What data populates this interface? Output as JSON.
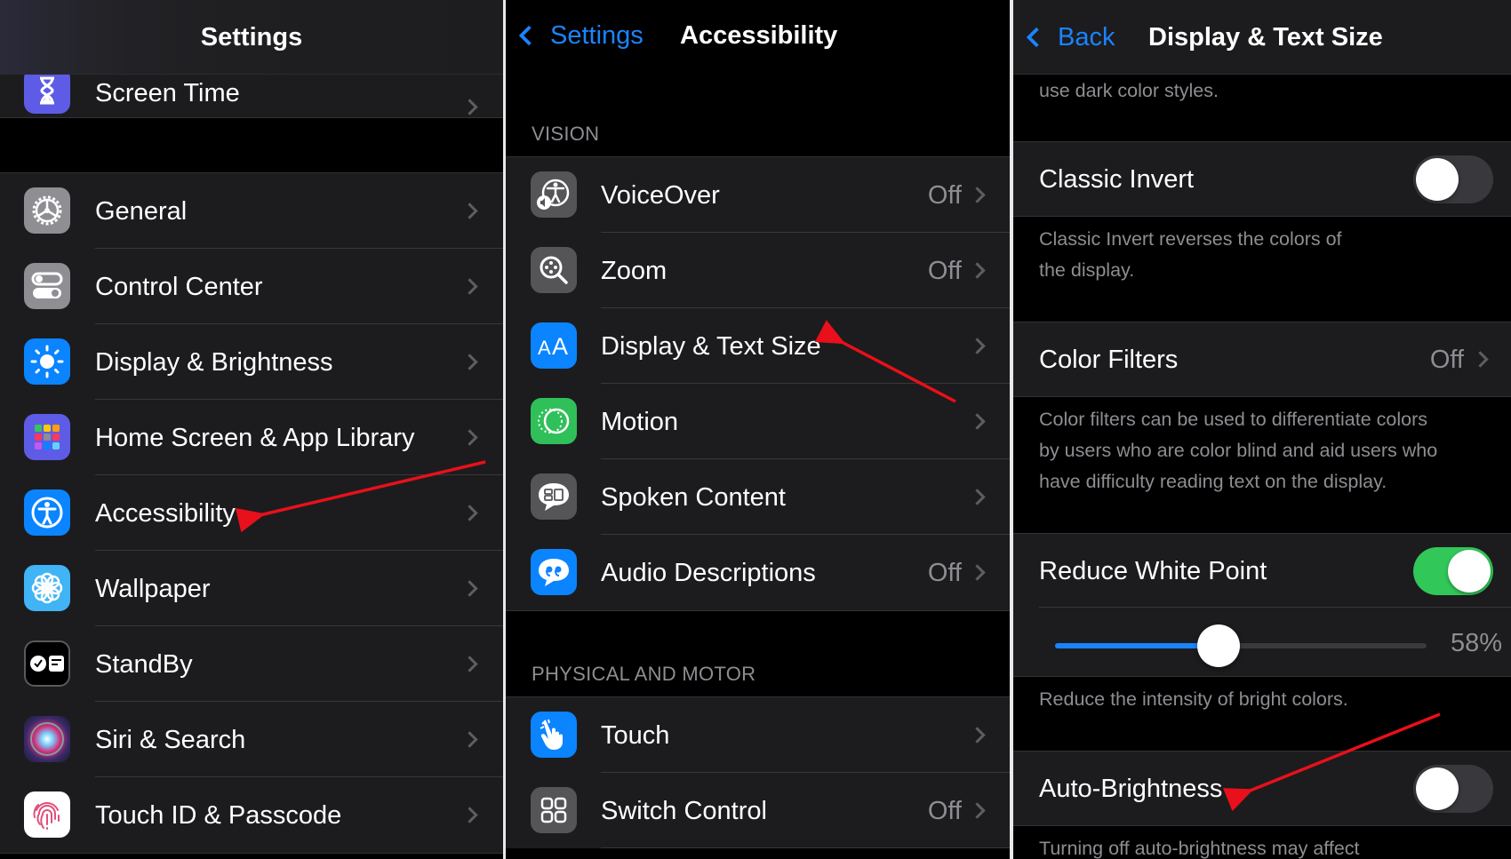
{
  "panels": {
    "settings": {
      "title": "Settings",
      "partial_row": {
        "label": "Screen Time",
        "icon": "hourglass-icon",
        "color": "#5e5ce6"
      },
      "rows": [
        {
          "label": "General",
          "icon": "gear-icon",
          "color": "#8e8e93"
        },
        {
          "label": "Control Center",
          "icon": "switches-icon",
          "color": "#8e8e93"
        },
        {
          "label": "Display & Brightness",
          "icon": "sun-icon",
          "color": "#0a84ff"
        },
        {
          "label": "Home Screen & App Library",
          "icon": "app-grid-icon",
          "color": "#5e5ce6"
        },
        {
          "label": "Accessibility",
          "icon": "accessibility-icon",
          "color": "#0a84ff"
        },
        {
          "label": "Wallpaper",
          "icon": "flower-icon",
          "color": "#40b4f5"
        },
        {
          "label": "StandBy",
          "icon": "standby-icon",
          "color": "#000000"
        },
        {
          "label": "Siri & Search",
          "icon": "siri-icon",
          "color": "#1a1a2e"
        },
        {
          "label": "Touch ID & Passcode",
          "icon": "fingerprint-icon",
          "color": "#ffffff"
        }
      ]
    },
    "accessibility": {
      "back_label": "Settings",
      "title": "Accessibility",
      "sections": [
        {
          "header": "VISION",
          "rows": [
            {
              "label": "VoiceOver",
              "value": "Off",
              "icon": "voiceover-icon",
              "color": "#555558"
            },
            {
              "label": "Zoom",
              "value": "Off",
              "icon": "zoom-icon",
              "color": "#555558"
            },
            {
              "label": "Display & Text Size",
              "value": "",
              "icon": "text-size-icon",
              "color": "#0a84ff"
            },
            {
              "label": "Motion",
              "value": "",
              "icon": "motion-icon",
              "color": "#30c05a"
            },
            {
              "label": "Spoken Content",
              "value": "",
              "icon": "speech-bubble-icon",
              "color": "#555558"
            },
            {
              "label": "Audio Descriptions",
              "value": "Off",
              "icon": "quote-bubble-icon",
              "color": "#0a84ff"
            }
          ]
        },
        {
          "header": "PHYSICAL AND MOTOR",
          "rows": [
            {
              "label": "Touch",
              "value": "",
              "icon": "hand-pointer-icon",
              "color": "#0a84ff"
            },
            {
              "label": "Switch Control",
              "value": "Off",
              "icon": "switch-grid-icon",
              "color": "#555558"
            }
          ]
        }
      ]
    },
    "display_text_size": {
      "back_label": "Back",
      "title": "Display & Text Size",
      "top_footer": "use dark color styles.",
      "classic_invert": {
        "label": "Classic Invert",
        "on": false,
        "footer": [
          "Classic Invert reverses the colors of",
          "the display."
        ]
      },
      "color_filters": {
        "label": "Color Filters",
        "value": "Off",
        "footer": [
          "Color filters can be used to differentiate colors",
          "by users who are color blind and aid users who",
          "have difficulty reading text on the display."
        ]
      },
      "reduce_white_point": {
        "label": "Reduce White Point",
        "on": true,
        "slider_percent": 58,
        "slider_label": "58%",
        "footer": "Reduce the intensity of bright colors."
      },
      "auto_brightness": {
        "label": "Auto-Brightness",
        "on": false,
        "footer": "Turning off auto-brightness may affect"
      }
    }
  },
  "colors": {
    "accent_blue": "#1a84ff",
    "toggle_on": "#31c759",
    "annotation_arrow": "#e8101a"
  }
}
